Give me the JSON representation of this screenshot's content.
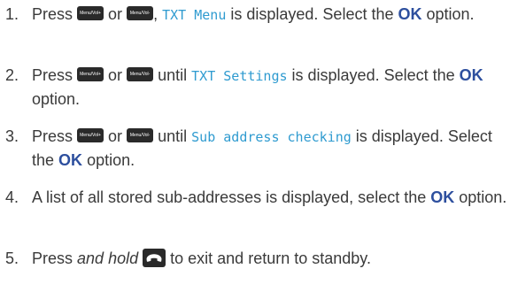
{
  "colors": {
    "text": "#3a3a3a",
    "lcd_text": "#2f9bd0",
    "ok_text": "#2d4f9e",
    "key_bg": "#2a2a2a"
  },
  "keys": {
    "up": "Menu/Vol+",
    "down": "Menu/Vol-",
    "end_icon": "phone-hangup-icon"
  },
  "steps": [
    {
      "number": "1.",
      "press": "Press",
      "or": "or",
      "after_keys": ",",
      "lcd": "TXT Menu",
      "middle": "is displayed. Select the",
      "ok": "OK",
      "end": "option."
    },
    {
      "number": "2.",
      "press": "Press",
      "or": "or",
      "until": "until",
      "lcd": "TXT Settings",
      "middle": "is displayed. Select the",
      "ok": "OK",
      "end": "option."
    },
    {
      "number": "3.",
      "press": "Press",
      "or": "or",
      "until": "until",
      "lcd": "Sub address checking",
      "middle": "is displayed. Select the",
      "ok": "OK",
      "end": "option."
    },
    {
      "number": "4.",
      "text": "A list of all stored sub-addresses is displayed, select the",
      "ok": "OK",
      "end": "option."
    },
    {
      "number": "5.",
      "press": "Press",
      "emphasis": "and hold",
      "end": "to exit and return to standby."
    }
  ]
}
